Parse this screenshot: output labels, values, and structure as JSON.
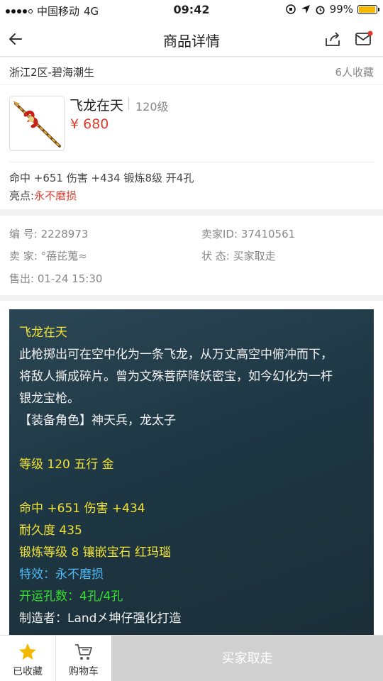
{
  "status": {
    "carrier": "中国移动",
    "network": "4G",
    "time": "09:42",
    "battery": "99%"
  },
  "nav": {
    "title": "商品详情"
  },
  "server": {
    "name": "浙江2区-碧海潮生",
    "favorites": "6人收藏"
  },
  "item": {
    "name": "飞龙在天",
    "level": "120级",
    "price": "¥ 680",
    "stats": "命中 +651 伤害 +434 锻炼8级 开4孔",
    "highlight_label": "亮点:",
    "highlight_value": "永不磨损"
  },
  "info": {
    "id_label": "编   号:",
    "id_value": "2228973",
    "seller_id_label": "卖家ID:",
    "seller_id_value": "37410561",
    "seller_label": "卖   家:",
    "seller_value": "°蓓芘蒐≈",
    "state_label": "状   态:",
    "state_value": "买家取走",
    "sold_label": "售出:",
    "sold_value": "01-24 15:30"
  },
  "description": {
    "title": "飞龙在天",
    "text1": "此枪掷出可在空中化为一条飞龙，从万丈高空中俯冲而下，",
    "text2": "将敌人撕成碎片。曾为文殊菩萨降妖密宝，如今幻化为一杆",
    "text3": "银龙宝枪。",
    "role": "【装备角色】神天兵，龙太子",
    "level_line": "等级 120 五行 金",
    "attr1": "命中 +651 伤害 +434",
    "attr2": "耐久度 435",
    "attr3": "锻炼等级 8 镶嵌宝石 红玛瑙",
    "effect": "特效：永不磨损",
    "holes": "开运孔数：4孔/4孔",
    "maker": "制造者：Land㐅坤仔强化打造"
  },
  "bottom": {
    "fav_label": "已收藏",
    "cart_label": "购物车",
    "action_label": "买家取走"
  },
  "colors": {
    "price": "#e03c2e",
    "accent": "#f5b800",
    "desc_bg": "#1e3744"
  }
}
